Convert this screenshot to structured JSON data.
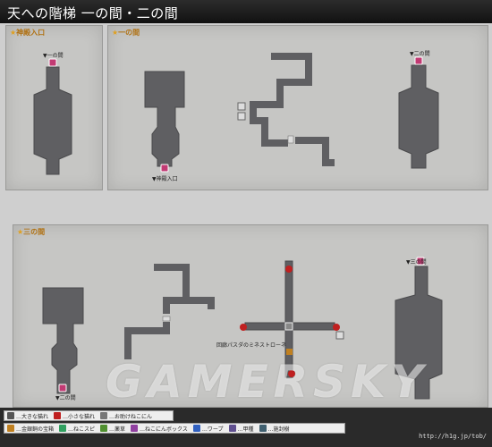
{
  "title": "天への階梯 一の間・二の間",
  "panels": {
    "entrance": "神殿入口",
    "room1": "一の間",
    "room3": "三の間"
  },
  "markers": {
    "to_room1_a": "▼一の間",
    "to_room2": "▼二の間",
    "to_entrance": "▼神殿入口",
    "to_room3": "▼三の間",
    "to_room2_b": "▼二の間",
    "switch_note": "回廊パスダのミネストローネ"
  },
  "watermark": "GAMERSKY",
  "legend": {
    "row1": [
      {
        "icon": "large-cat-icon",
        "color": "#555",
        "label": "…大きな猫れ"
      },
      {
        "icon": "small-cat-icon",
        "color": "#c02020",
        "label": "…小さな猫れ"
      },
      {
        "icon": "help-cat-icon",
        "color": "#777",
        "label": "…お助けねこにん"
      }
    ],
    "row2": [
      {
        "icon": "treasure-icon",
        "color": "#c08020",
        "label": "…金銀銅の宝箱"
      },
      {
        "icon": "neko-spirit-icon",
        "color": "#30a060",
        "label": "…ねこスピ"
      },
      {
        "icon": "herb-icon",
        "color": "#509030",
        "label": "…薬草"
      },
      {
        "icon": "neko-box-icon",
        "color": "#9040a0",
        "label": "…ねこにんボックス"
      },
      {
        "icon": "warp-icon",
        "color": "#3060c0",
        "label": "…ワープ"
      },
      {
        "icon": "armor-icon",
        "color": "#605090",
        "label": "…甲種"
      },
      {
        "icon": "sealed-stone-icon",
        "color": "#406070",
        "label": "…施封樹"
      }
    ]
  },
  "url": "http://h1g.jp/tob/"
}
